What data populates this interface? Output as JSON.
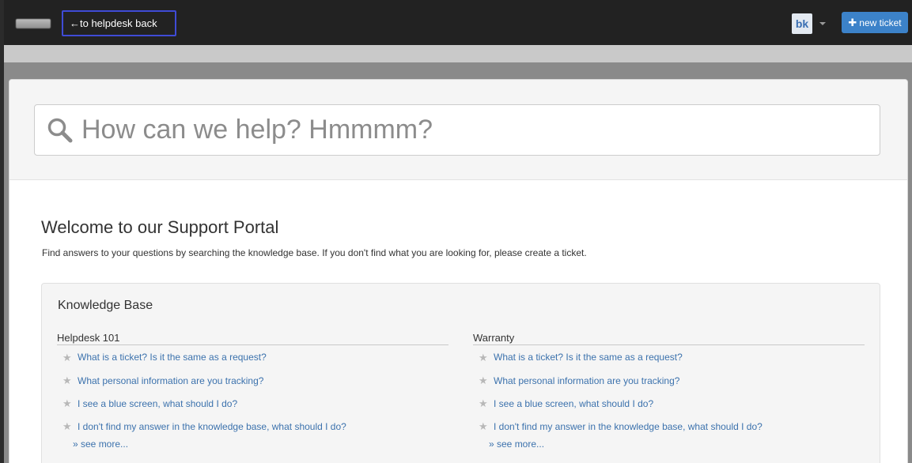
{
  "header": {
    "back_label": "←to helpdesk back",
    "user_initials": "bk",
    "new_ticket_label": "new ticket"
  },
  "search": {
    "placeholder": "How can we help? Hmmmm?"
  },
  "welcome": {
    "title": "Welcome to our Support Portal",
    "text": "Find answers to your questions by searching the knowledge base. If you don't find what you are looking for, please create a ticket."
  },
  "kb": {
    "title": "Knowledge Base",
    "categories": [
      {
        "name": "Helpdesk 101",
        "items": [
          "What is a ticket? Is it the same as a request?",
          "What personal information are you tracking?",
          "I see a blue screen, what should I do?",
          "I don't find my answer in the knowledge base, what should I do?"
        ],
        "see_more": "» see more..."
      },
      {
        "name": "Warranty",
        "items": [
          "What is a ticket? Is it the same as a request?",
          "What personal information are you tracking?",
          "I see a blue screen, what should I do?",
          "I don't find my answer in the knowledge base, what should I do?"
        ],
        "see_more": "» see more..."
      }
    ]
  },
  "colors": {
    "topbar": "#222222",
    "accent": "#3c82c9",
    "link": "#3c72ad",
    "highlight_border": "#3f4bd6"
  }
}
